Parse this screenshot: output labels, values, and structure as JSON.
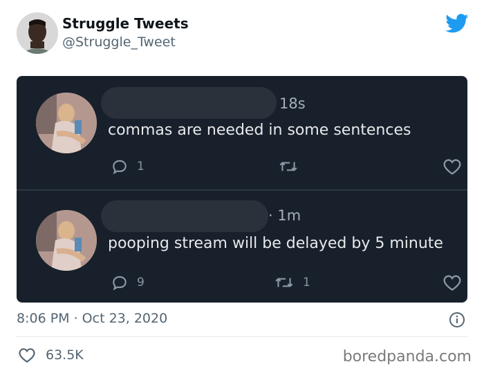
{
  "author": {
    "name": "Struggle Tweets",
    "handle": "@Struggle_Tweet"
  },
  "embedded_tweets": [
    {
      "time": "18s",
      "text": "commas are needed in some sentences",
      "reply_count": "1",
      "retweet_count": ""
    },
    {
      "time": "· 1m",
      "text": "pooping stream will be delayed by 5 minute",
      "reply_count": "9",
      "retweet_count": "1"
    }
  ],
  "timestamp": "8:06 PM · Oct 23, 2020",
  "like_count": "63.5K",
  "watermark": "boredpanda.com",
  "colors": {
    "twitter_blue": "#1d9bf0",
    "embed_background": "#17202b"
  }
}
